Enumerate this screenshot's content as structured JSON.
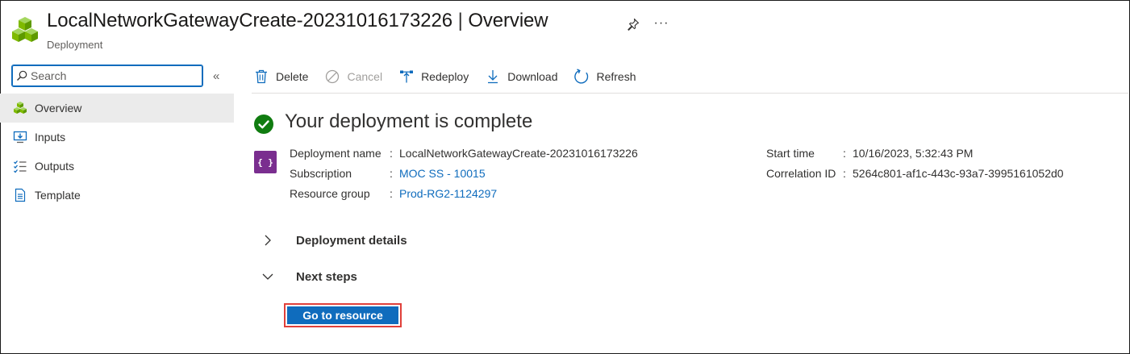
{
  "header": {
    "title": "LocalNetworkGatewayCreate-20231016173226",
    "title_separator": "|",
    "view": "Overview",
    "subtitle": "Deployment",
    "more_label": "···"
  },
  "sidebar": {
    "search": {
      "placeholder": "Search",
      "value": ""
    },
    "collapse_label": "«",
    "items": [
      {
        "label": "Overview",
        "icon": "overview-cubes-icon",
        "active": true
      },
      {
        "label": "Inputs",
        "icon": "inputs-icon",
        "active": false
      },
      {
        "label": "Outputs",
        "icon": "outputs-icon",
        "active": false
      },
      {
        "label": "Template",
        "icon": "template-icon",
        "active": false
      }
    ]
  },
  "toolbar": {
    "delete": "Delete",
    "cancel": "Cancel",
    "redeploy": "Redeploy",
    "download": "Download",
    "refresh": "Refresh"
  },
  "main": {
    "status_title": "Your deployment is complete",
    "deploy_icon_text": "{ }",
    "details_left": [
      {
        "label": "Deployment name",
        "value": "LocalNetworkGatewayCreate-20231016173226",
        "link": false
      },
      {
        "label": "Subscription",
        "value": "MOC SS - 10015",
        "link": true
      },
      {
        "label": "Resource group",
        "value": "Prod-RG2-1124297",
        "link": true
      }
    ],
    "details_right": [
      {
        "label": "Start time",
        "value": "10/16/2023, 5:32:43 PM"
      },
      {
        "label": "Correlation ID",
        "value": "5264c801-af1c-443c-93a7-3995161052d0"
      }
    ],
    "colon": ":",
    "sections": [
      {
        "label": "Deployment details",
        "expanded": false
      },
      {
        "label": "Next steps",
        "expanded": true
      }
    ],
    "goto_button": "Go to resource"
  },
  "colors": {
    "accent": "#0f6cbd",
    "success": "#107c10",
    "deploy_icon_bg": "#7a2e8f",
    "highlight_border": "#e0403a"
  }
}
